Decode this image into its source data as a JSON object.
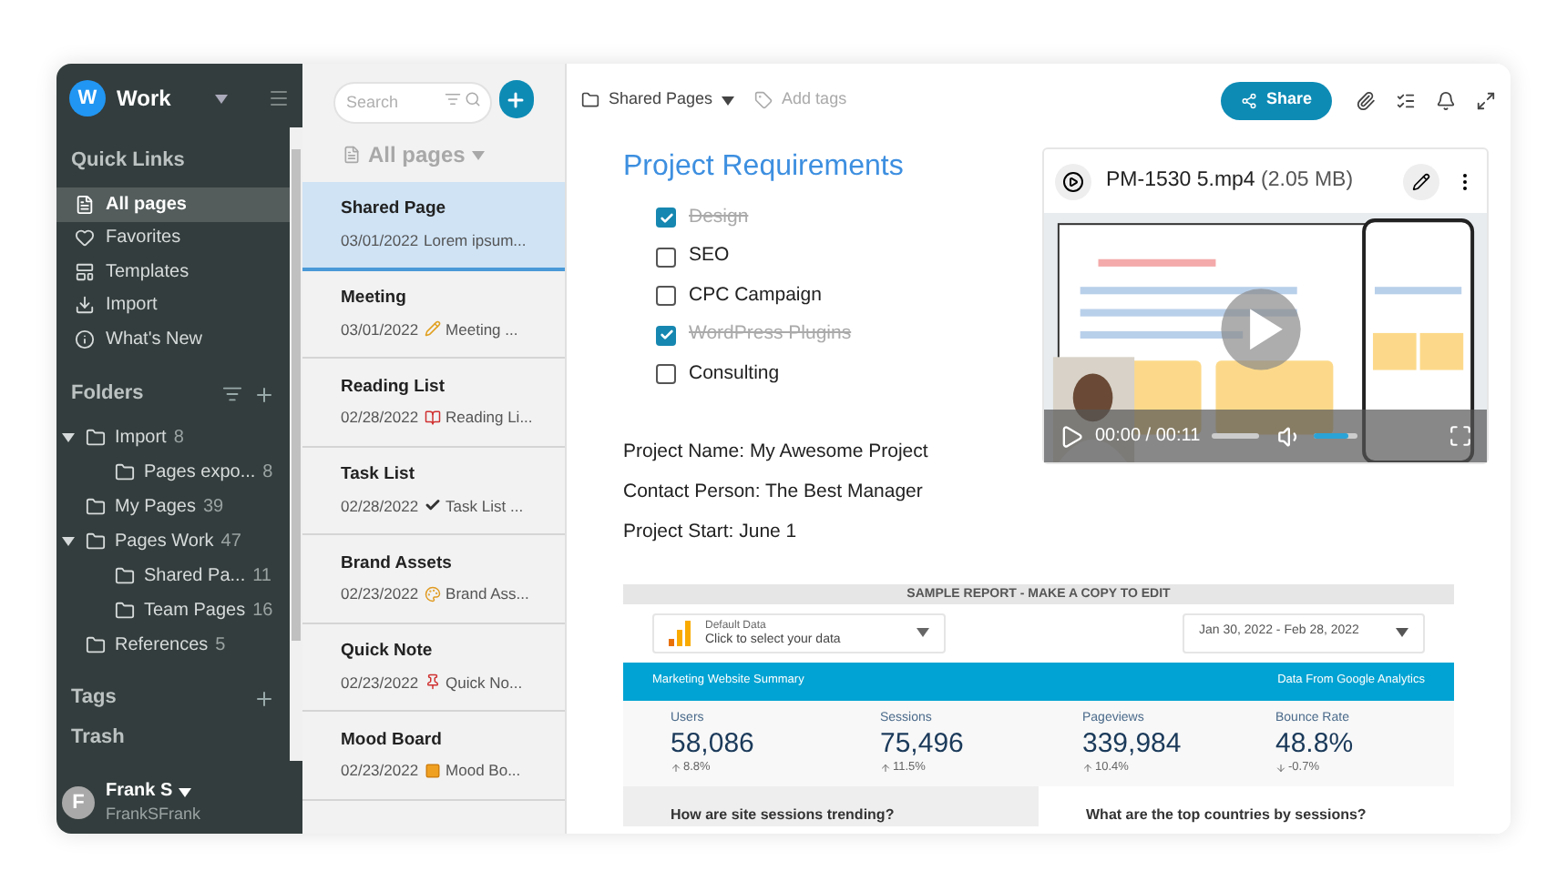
{
  "workspace": {
    "initial": "W",
    "name": "Work"
  },
  "quick_links": {
    "title": "Quick Links",
    "items": [
      {
        "label": "All pages",
        "selected": true
      },
      {
        "label": "Favorites",
        "selected": false
      },
      {
        "label": "Templates",
        "selected": false
      },
      {
        "label": "Import",
        "selected": false
      },
      {
        "label": "What's New",
        "selected": false
      }
    ]
  },
  "folders": {
    "title": "Folders",
    "items": [
      {
        "label": "Import",
        "count": "8",
        "expanded": true,
        "children": [
          {
            "label": "Pages expo...",
            "count": "8"
          }
        ]
      },
      {
        "label": "My Pages",
        "count": "39"
      },
      {
        "label": "Pages Work",
        "count": "47",
        "expanded": true,
        "children": [
          {
            "label": "Shared Pa...",
            "count": "11"
          },
          {
            "label": "Team Pages",
            "count": "16"
          }
        ]
      },
      {
        "label": "References",
        "count": "5"
      }
    ]
  },
  "tags": "Tags",
  "trash": "Trash",
  "user": {
    "initial": "F",
    "name": "Frank S",
    "handle": "FrankSFrank"
  },
  "page_list": {
    "search": {
      "placeholder": "Search"
    },
    "header": "All pages",
    "pages": [
      {
        "title": "Shared Page",
        "date": "03/01/2022",
        "preview": "Lorem ipsum...",
        "selected": true
      },
      {
        "title": "Meeting",
        "date": "03/01/2022",
        "kind": "pencil",
        "preview": "Meeting ...",
        "selected": false
      },
      {
        "title": "Reading List",
        "date": "02/28/2022",
        "kind": "book",
        "preview": "Reading Li...",
        "selected": false
      },
      {
        "title": "Task List",
        "date": "02/28/2022",
        "kind": "check",
        "preview": "Task List ...",
        "selected": false
      },
      {
        "title": "Brand Assets",
        "date": "02/23/2022",
        "kind": "palette",
        "preview": "Brand Ass...",
        "selected": false
      },
      {
        "title": "Quick Note",
        "date": "02/23/2022",
        "kind": "pin",
        "preview": "Quick No...",
        "selected": false
      },
      {
        "title": "Mood Board",
        "date": "02/23/2022",
        "kind": "board",
        "preview": "Mood Bo...",
        "selected": false
      }
    ]
  },
  "toolbar": {
    "breadcrumb": "Shared Pages",
    "add_tags": "Add tags",
    "share": "Share"
  },
  "title": "Project Requirements",
  "checklist": [
    {
      "label": "Design",
      "checked": true
    },
    {
      "label": "SEO",
      "checked": false
    },
    {
      "label": "CPC Campaign",
      "checked": false
    },
    {
      "label": "WordPress Plugins",
      "checked": true
    },
    {
      "label": "Consulting",
      "checked": false
    }
  ],
  "paragraphs": [
    "Project Name: My Awesome Project",
    "Contact Person: The Best Manager",
    "Project Start: June 1"
  ],
  "video": {
    "name": "PM-1530 5.mp4",
    "size": "(2.05 MB)",
    "time": "00:00 / 00:11",
    "progress": {
      "level": 0
    },
    "volume": {
      "level": 0.8
    }
  },
  "report": {
    "banner": "SAMPLE REPORT - MAKE A COPY TO EDIT",
    "source": {
      "label": "Default Data",
      "value": "Click to select your data"
    },
    "date_range": "Jan 30, 2022 - Feb 28, 2022",
    "header_left": "Marketing Website Summary",
    "header_right": "Data From Google Analytics",
    "metrics": [
      {
        "label": "Users",
        "value": "58,086",
        "change": "8.8%",
        "kind": "up"
      },
      {
        "label": "Sessions",
        "value": "75,496",
        "change": "11.5%",
        "kind": "up"
      },
      {
        "label": "Pageviews",
        "value": "339,984",
        "change": "10.4%",
        "kind": "up"
      },
      {
        "label": "Bounce Rate",
        "value": "48.8%",
        "change": "-0.7%",
        "kind": "down"
      }
    ],
    "questions": [
      "How are site sessions trending?",
      "What are the top countries by sessions?"
    ]
  }
}
